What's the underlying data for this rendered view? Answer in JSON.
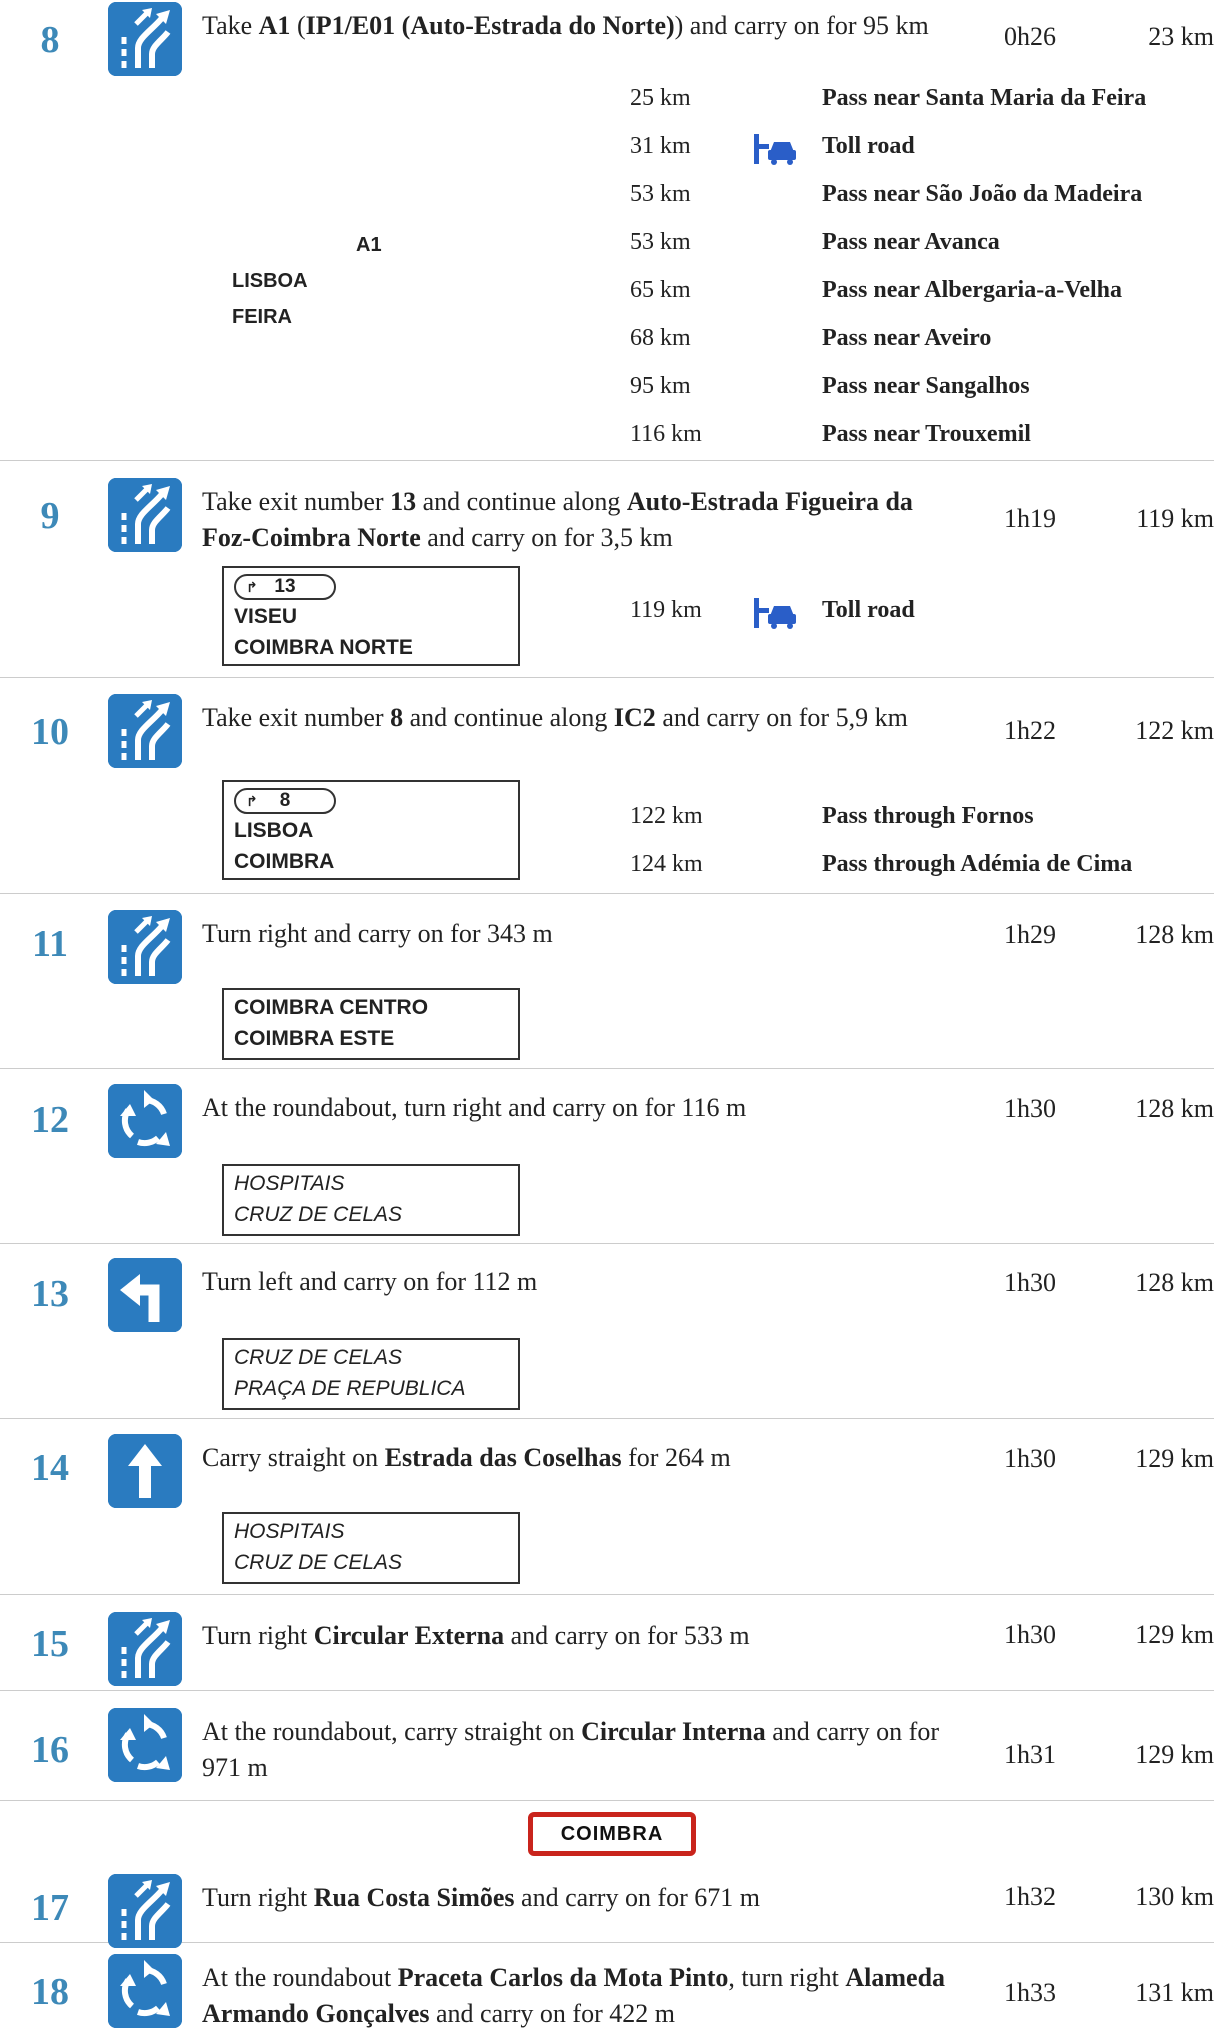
{
  "steps": [
    {
      "num": "8",
      "icon": "exit-ramp-icon",
      "instr_html": "Take <b>A1</b> (<b>IP1/E01 (Auto-Estrada do Norte)</b>) and carry on for 95 km",
      "time": "0h26",
      "dist": "23 km",
      "sign_labels": {
        "road": "A1",
        "line1": "LISBOA",
        "line2": "FEIRA"
      },
      "waypoints": [
        {
          "km": "25 km",
          "text": "Pass near Santa Maria da Feira",
          "toll": false
        },
        {
          "km": "31 km",
          "text": "Toll road",
          "toll": true
        },
        {
          "km": "53 km",
          "text": "Pass near São João da Madeira",
          "toll": false
        },
        {
          "km": "53 km",
          "text": "Pass near Avanca",
          "toll": false
        },
        {
          "km": "65 km",
          "text": "Pass near Albergaria-a-Velha",
          "toll": false
        },
        {
          "km": "68 km",
          "text": "Pass near Aveiro",
          "toll": false
        },
        {
          "km": "95 km",
          "text": "Pass near Sangalhos",
          "toll": false
        },
        {
          "km": "116 km",
          "text": "Pass near Trouxemil",
          "toll": false
        }
      ]
    },
    {
      "num": "9",
      "icon": "exit-ramp-icon",
      "instr_html": "Take exit number <b>13</b> and continue along <b>Auto-Estrada Figueira da Foz-Coimbra Norte</b> and carry on for 3,5 km",
      "time": "1h19",
      "dist": "119 km",
      "sign": {
        "exit": "13",
        "lines": [
          "VISEU",
          "COIMBRA NORTE"
        ]
      },
      "waypoints": [
        {
          "km": "119 km",
          "text": "Toll road",
          "toll": true
        }
      ]
    },
    {
      "num": "10",
      "icon": "exit-ramp-icon",
      "instr_html": "Take exit number <b>8</b> and continue along <b>IC2</b> and carry on for 5,9 km",
      "time": "1h22",
      "dist": "122 km",
      "sign": {
        "exit": "8",
        "lines": [
          "LISBOA",
          "COIMBRA"
        ]
      },
      "waypoints": [
        {
          "km": "122 km",
          "text": "Pass through Fornos",
          "toll": false
        },
        {
          "km": "124 km",
          "text": "Pass through Adémia de Cima",
          "toll": false
        }
      ]
    },
    {
      "num": "11",
      "icon": "exit-ramp-icon",
      "instr_html": "Turn right and carry on for 343 m",
      "time": "1h29",
      "dist": "128 km",
      "sign": {
        "lines": [
          "COIMBRA CENTRO",
          "COIMBRA ESTE"
        ]
      }
    },
    {
      "num": "12",
      "icon": "roundabout-icon",
      "instr_html": "At the roundabout, turn right and carry on for 116 m",
      "time": "1h30",
      "dist": "128 km",
      "sign": {
        "italic": true,
        "lines": [
          "HOSPITAIS",
          "CRUZ DE CELAS"
        ]
      }
    },
    {
      "num": "13",
      "icon": "turn-left-icon",
      "instr_html": "Turn left and carry on for 112 m",
      "time": "1h30",
      "dist": "128 km",
      "sign": {
        "italic": true,
        "lines": [
          "CRUZ DE CELAS",
          "PRAÇA DE REPUBLICA"
        ]
      }
    },
    {
      "num": "14",
      "icon": "straight-arrow-icon",
      "instr_html": "Carry straight on <b>Estrada das Coselhas</b> for 264 m",
      "time": "1h30",
      "dist": "129 km",
      "sign": {
        "italic": true,
        "lines": [
          "HOSPITAIS",
          "CRUZ DE CELAS"
        ]
      }
    },
    {
      "num": "15",
      "icon": "exit-ramp-icon",
      "instr_html": "Turn right <b>Circular Externa</b> and carry on for 533 m",
      "time": "1h30",
      "dist": "129 km"
    },
    {
      "num": "16",
      "icon": "roundabout-icon",
      "instr_html": "At the roundabout, carry straight on <b>Circular Interna</b> and carry on for 971 m",
      "time": "1h31",
      "dist": "129 km"
    },
    {
      "num": "17",
      "icon": "exit-ramp-icon",
      "instr_html": "Turn right <b>Rua Costa Simões</b> and carry on for 671 m",
      "time": "1h32",
      "dist": "130 km"
    },
    {
      "num": "18",
      "icon": "roundabout-icon",
      "instr_html": "At the roundabout <b>Praceta Carlos da Mota Pinto</b>, turn right <b>Alameda Armando Gonçalves</b> and carry on for 422 m",
      "time": "1h33",
      "dist": "131 km"
    }
  ],
  "city_sign": "COIMBRA"
}
